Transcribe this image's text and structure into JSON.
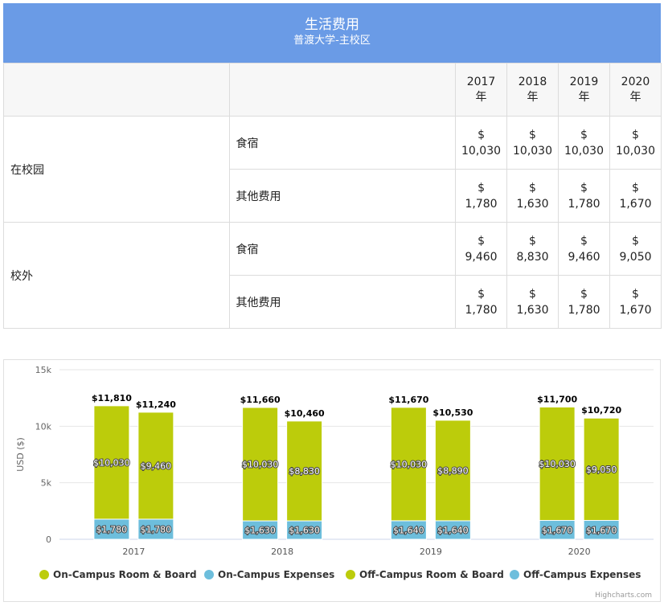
{
  "header": {
    "title": "生活费用",
    "subtitle": "普渡大学-主校区"
  },
  "table": {
    "year_headers": [
      [
        "2017",
        "年"
      ],
      [
        "2018",
        "年"
      ],
      [
        "2019",
        "年"
      ],
      [
        "2020",
        "年"
      ]
    ],
    "groups": [
      {
        "label": "在校园",
        "rows": [
          {
            "label": "食宿",
            "cells": [
              [
                "$",
                "10,030"
              ],
              [
                "$",
                "10,030"
              ],
              [
                "$",
                "10,030"
              ],
              [
                "$",
                "10,030"
              ]
            ]
          },
          {
            "label": "其他费用",
            "cells": [
              [
                "$",
                "1,780"
              ],
              [
                "$",
                "1,630"
              ],
              [
                "$",
                "1,780"
              ],
              [
                "$",
                "1,670"
              ]
            ]
          }
        ]
      },
      {
        "label": "校外",
        "rows": [
          {
            "label": "食宿",
            "cells": [
              [
                "$",
                "9,460"
              ],
              [
                "$",
                "8,830"
              ],
              [
                "$",
                "9,460"
              ],
              [
                "$",
                "9,050"
              ]
            ]
          },
          {
            "label": "其他费用",
            "cells": [
              [
                "$",
                "1,780"
              ],
              [
                "$",
                "1,630"
              ],
              [
                "$",
                "1,780"
              ],
              [
                "$",
                "1,670"
              ]
            ]
          }
        ]
      }
    ]
  },
  "chart_data": {
    "type": "bar",
    "stacked": true,
    "categories": [
      "2017",
      "2018",
      "2019",
      "2020"
    ],
    "ylabel": "USD ($)",
    "ylim": [
      0,
      15000
    ],
    "y_ticks": [
      "0",
      "5k",
      "10k",
      "15k"
    ],
    "stacks": [
      {
        "stack": "on-campus",
        "series": [
          {
            "name": "On-Campus Expenses",
            "color": "#6dbedc",
            "values": [
              1780,
              1630,
              1640,
              1670
            ],
            "labels": [
              "$1,780",
              "$1,630",
              "$1,640",
              "$1,670"
            ]
          },
          {
            "name": "On-Campus Room & Board",
            "color": "#bccc0b",
            "values": [
              10030,
              10030,
              10030,
              10030
            ],
            "labels": [
              "$10,030",
              "$10,030",
              "$10,030",
              "$10,030"
            ]
          }
        ],
        "totals": [
          "$11,810",
          "$11,660",
          "$11,670",
          "$11,700"
        ]
      },
      {
        "stack": "off-campus",
        "series": [
          {
            "name": "Off-Campus Expenses",
            "color": "#6dbedc",
            "values": [
              1780,
              1630,
              1640,
              1670
            ],
            "labels": [
              "$1,780",
              "$1,630",
              "$1,640",
              "$1,670"
            ]
          },
          {
            "name": "Off-Campus Room & Board",
            "color": "#bccc0b",
            "values": [
              9460,
              8830,
              8890,
              9050
            ],
            "labels": [
              "$9,460",
              "$8,830",
              "$8,890",
              "$9,050"
            ]
          }
        ],
        "totals": [
          "$11,240",
          "$10,460",
          "$10,530",
          "$10,720"
        ]
      }
    ],
    "legend": {
      "position": "bottom",
      "items": [
        {
          "name": "On-Campus Room & Board",
          "color": "#bccc0b"
        },
        {
          "name": "On-Campus Expenses",
          "color": "#6dbedc"
        },
        {
          "name": "Off-Campus Room & Board",
          "color": "#bccc0b"
        },
        {
          "name": "Off-Campus Expenses",
          "color": "#6dbedc"
        }
      ]
    },
    "credits": "Highcharts.com",
    "grid": true
  }
}
